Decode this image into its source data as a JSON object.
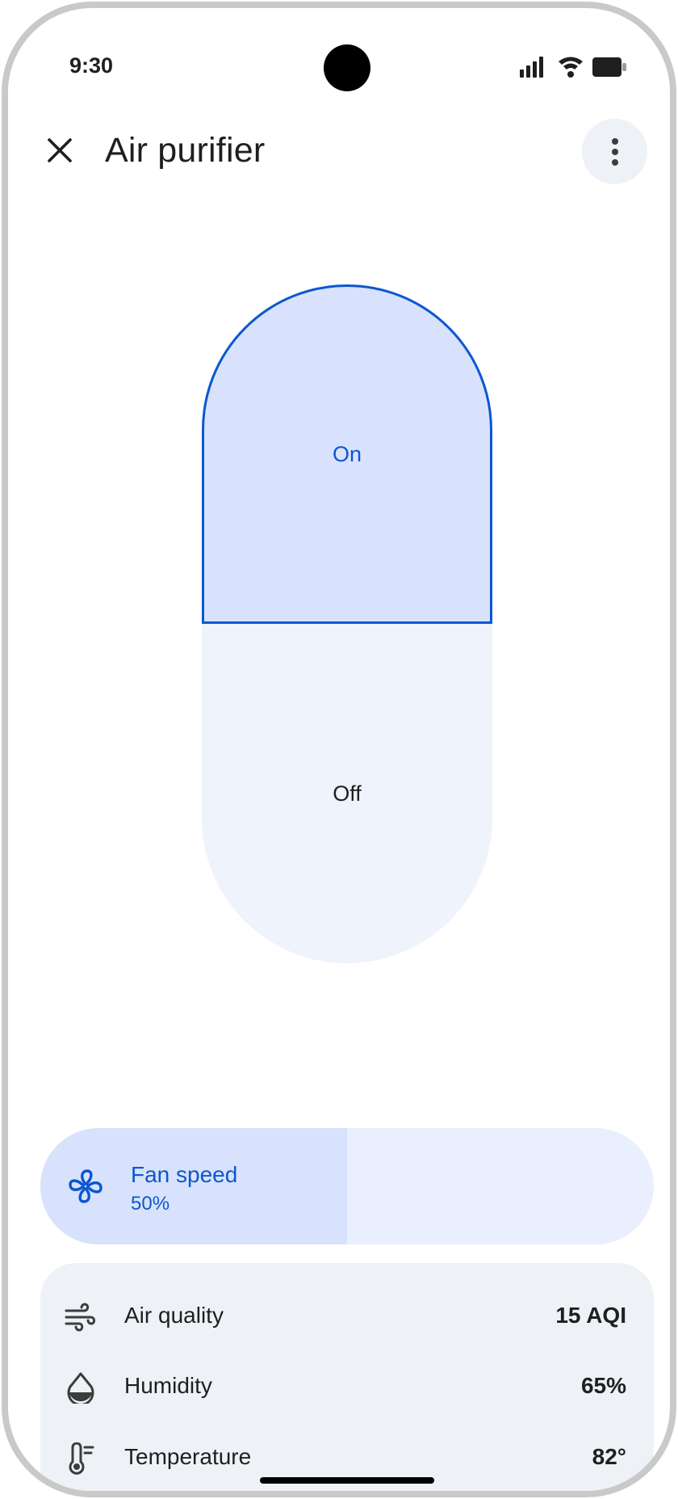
{
  "status_bar": {
    "time": "9:30",
    "icons": [
      "cellular-signal-icon",
      "wifi-icon",
      "battery-icon"
    ]
  },
  "app_bar": {
    "title": "Air purifier",
    "close_icon": "close-icon",
    "more_icon": "more-vert-icon"
  },
  "power_toggle": {
    "on_label": "On",
    "off_label": "Off",
    "selected": "On"
  },
  "fan_speed": {
    "label": "Fan speed",
    "value_text": "50%",
    "level": 0.5,
    "icon": "fan-icon"
  },
  "sensors": [
    {
      "icon": "air-wind-icon",
      "label": "Air quality",
      "value": "15 AQI"
    },
    {
      "icon": "humidity-drop-icon",
      "label": "Humidity",
      "value": "65%"
    },
    {
      "icon": "thermometer-icon",
      "label": "Temperature",
      "value": "82°"
    }
  ],
  "colors": {
    "accent": "#0b57d0",
    "selected_fill": "#d8e2fc",
    "unselected_fill": "#eef3fc",
    "card_background": "#eef1f6"
  }
}
